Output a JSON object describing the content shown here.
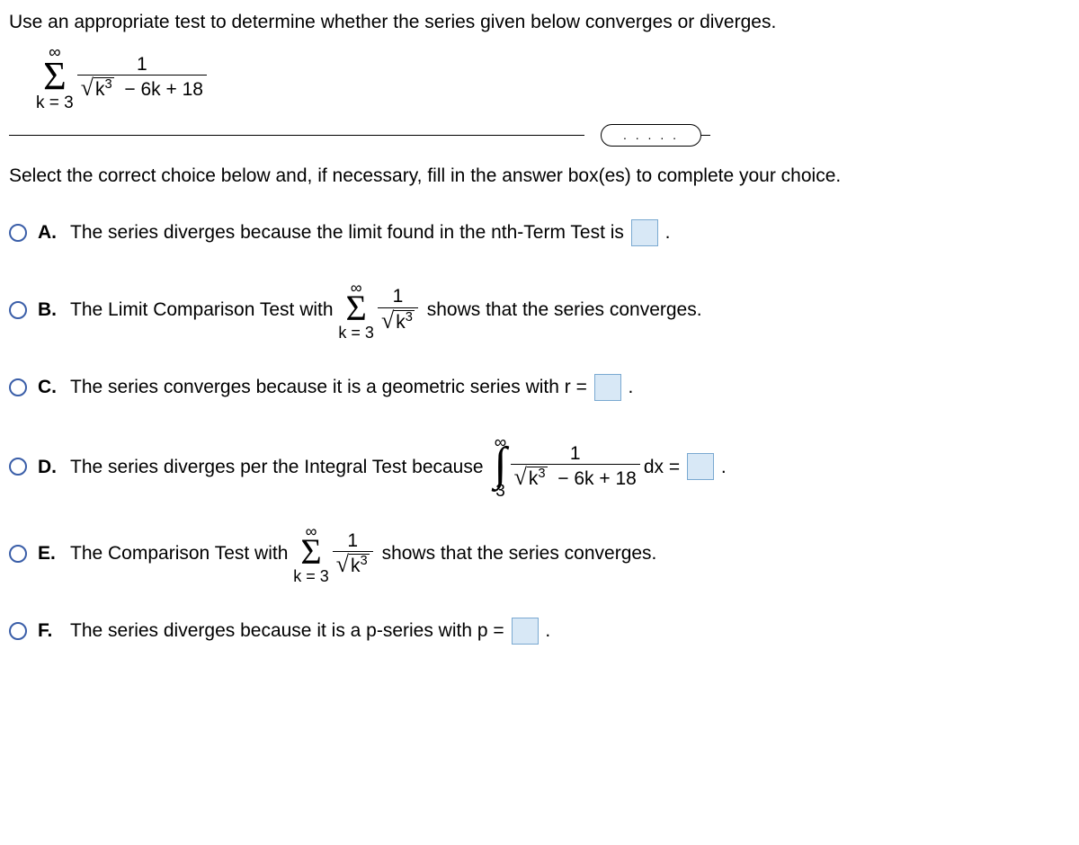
{
  "prompt": "Use an appropriate test to determine whether the series given below converges or diverges.",
  "series": {
    "upper": "∞",
    "lower": "k = 3",
    "num": "1",
    "radicand": "k",
    "exponent": "3",
    "rest": "− 6k + 18"
  },
  "bubble": ". . . . .",
  "instruction": "Select the correct choice below and, if necessary, fill in the answer box(es) to complete your choice.",
  "choices": {
    "A": {
      "letter": "A.",
      "text": "The series diverges because the limit found in the nth-Term Test is",
      "period": "."
    },
    "B": {
      "letter": "B.",
      "text1": "The Limit Comparison Test with",
      "sum_upper": "∞",
      "sum_lower": "k = 3",
      "sum_num": "1",
      "sum_rad": "k",
      "sum_exp": "3",
      "text2": "shows that the series converges."
    },
    "C": {
      "letter": "C.",
      "text": "The series converges because it is a geometric series with r =",
      "period": "."
    },
    "D": {
      "letter": "D.",
      "text1": "The series diverges per the Integral Test because",
      "int_upper": "∞",
      "int_lower": "3",
      "int_num": "1",
      "int_rad": "k",
      "int_exp": "3",
      "int_rest": "− 6k + 18",
      "dx": "dx =",
      "period": "."
    },
    "E": {
      "letter": "E.",
      "text1": "The Comparison Test with",
      "sum_upper": "∞",
      "sum_lower": "k = 3",
      "sum_num": "1",
      "sum_rad": "k",
      "sum_exp": "3",
      "text2": "shows that the series converges."
    },
    "F": {
      "letter": "F.",
      "text": "The series diverges because it is a p-series with p =",
      "period": "."
    }
  }
}
